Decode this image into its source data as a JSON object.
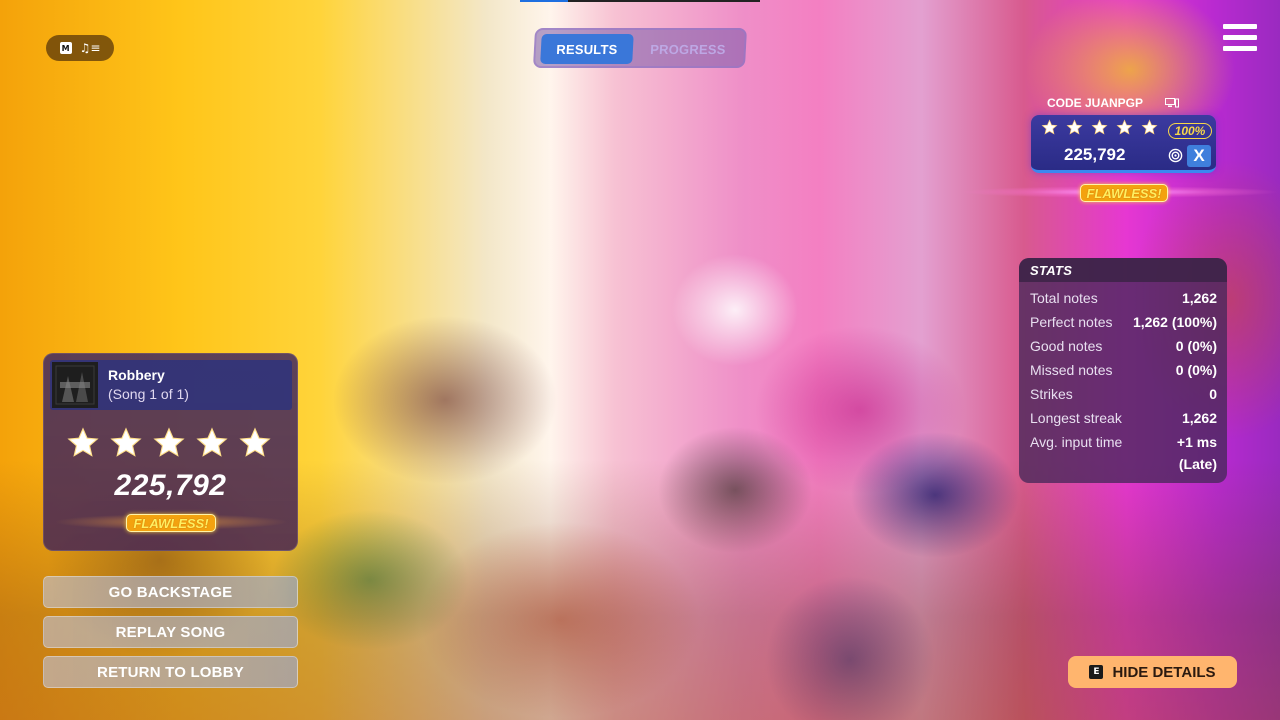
{
  "input_hint": {
    "key": "M",
    "icon": "music-notes-list-icon"
  },
  "tabs": [
    {
      "label": "RESULTS",
      "active": true
    },
    {
      "label": "PROGRESS",
      "active": false
    }
  ],
  "player": {
    "name": "CODE JUANPGP",
    "platform_icon": "pc-icon",
    "stars": 5,
    "accuracy": "100%",
    "score": "225,792",
    "badge": "FLAWLESS!",
    "instrument_icon": "target-icon",
    "controller_button": "X"
  },
  "stats": {
    "title": "STATS",
    "rows": [
      {
        "label": "Total notes",
        "value": "1,262"
      },
      {
        "label": "Perfect notes",
        "value": "1,262 (100%)"
      },
      {
        "label": "Good notes",
        "value": "0 (0%)"
      },
      {
        "label": "Missed notes",
        "value": "0 (0%)"
      },
      {
        "label": "Strikes",
        "value": "0"
      },
      {
        "label": "Longest streak",
        "value": "1,262"
      },
      {
        "label": "Avg. input time",
        "value": "+1 ms"
      }
    ],
    "avg_input_note": "(Late)"
  },
  "song": {
    "title": "Robbery",
    "subtitle": "(Song 1 of 1)",
    "stars": 5,
    "score": "225,792",
    "badge": "FLAWLESS!"
  },
  "buttons": {
    "go_backstage": "GO BACKSTAGE",
    "replay_song": "REPLAY SONG",
    "return_to_lobby": "RETURN TO LOBBY",
    "hide_details": "HIDE DETAILS",
    "hide_details_key": "E"
  },
  "colors": {
    "accent_blue": "#3a77d9",
    "flawless_gold": "#f3a20f",
    "hide_details_bg": "#ffb56e"
  }
}
